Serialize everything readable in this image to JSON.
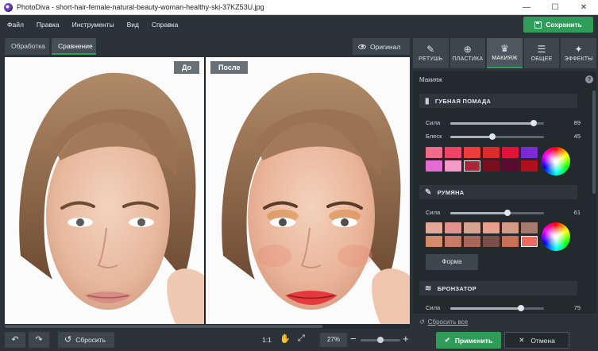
{
  "window": {
    "app_name": "PhotoDiva",
    "file_name": "short-hair-female-natural-beauty-woman-healthy-ski-37KZ53U.jpg",
    "title_separator": " - ",
    "controls": {
      "minimize": "—",
      "maximize": "☐",
      "close": "✕"
    }
  },
  "menu": {
    "items": [
      "Файл",
      "Правка",
      "Инструменты",
      "Вид",
      "Справка"
    ],
    "save_label": "Сохранить"
  },
  "view_tabs": [
    {
      "label": "Обработка",
      "active": false
    },
    {
      "label": "Сравнение",
      "active": true
    }
  ],
  "original_button": "Оригинал",
  "photos": {
    "before_label": "До",
    "after_label": "После"
  },
  "bottom": {
    "reset_label": "Сбросить",
    "zoom_1to1": "1:1",
    "zoom_value": "27%",
    "zoom_level": 0.5,
    "apply_label": "Применить",
    "cancel_label": "Отмена",
    "undo_icon": "↶",
    "redo_icon": "↷"
  },
  "panel": {
    "tabs": [
      {
        "label": "РЕТУШЬ",
        "icon": "retouch-icon",
        "glyph": "✎",
        "active": false
      },
      {
        "label": "ПЛАСТИКА",
        "icon": "plastic-icon",
        "glyph": "⊕",
        "active": false
      },
      {
        "label": "МАКИЯЖ",
        "icon": "makeup-icon",
        "glyph": "♛",
        "active": true
      },
      {
        "label": "ОБЩЕЕ",
        "icon": "general-icon",
        "glyph": "☰",
        "active": false
      },
      {
        "label": "ЭФФЕКТЫ",
        "icon": "effects-icon",
        "glyph": "✦",
        "active": false
      }
    ],
    "heading": "Макияж",
    "help": "?",
    "lipstick": {
      "title": "ГУБНАЯ ПОМАДА",
      "strength_label": "Сила",
      "strength_value": "89",
      "strength": 89,
      "gloss_label": "Блеск",
      "gloss_value": "45",
      "gloss": 45,
      "swatches": [
        "#f06a8a",
        "#f04466",
        "#ee3b3b",
        "#dd2a2a",
        "#e3123a",
        "#7b2bd6",
        "#e36bd2",
        "#f49ac6",
        "#a8283a",
        "#7a0f1e",
        "#5a0a2e",
        "#b0101c"
      ],
      "selected_swatch": 8
    },
    "blush": {
      "title": "РУМЯНА",
      "strength_label": "Сила",
      "strength_value": "61",
      "strength": 61,
      "swatches": [
        "#e2a89a",
        "#e0938f",
        "#d6a48e",
        "#e8a08d",
        "#d69a88",
        "#a67a6e",
        "#d68a6a",
        "#c77a66",
        "#a86656",
        "#7a4f4a",
        "#c97056",
        "#ec6a60"
      ],
      "selected_swatch": 11,
      "shape_label": "Форма"
    },
    "bronzer": {
      "title": "БРОНЗАТОР",
      "strength_label": "Сила",
      "strength_value": "75",
      "strength": 75
    },
    "reset_all": "Сбросить все"
  },
  "colors": {
    "accent_green": "#2f9c5a",
    "panel_bg": "#2b3338"
  }
}
